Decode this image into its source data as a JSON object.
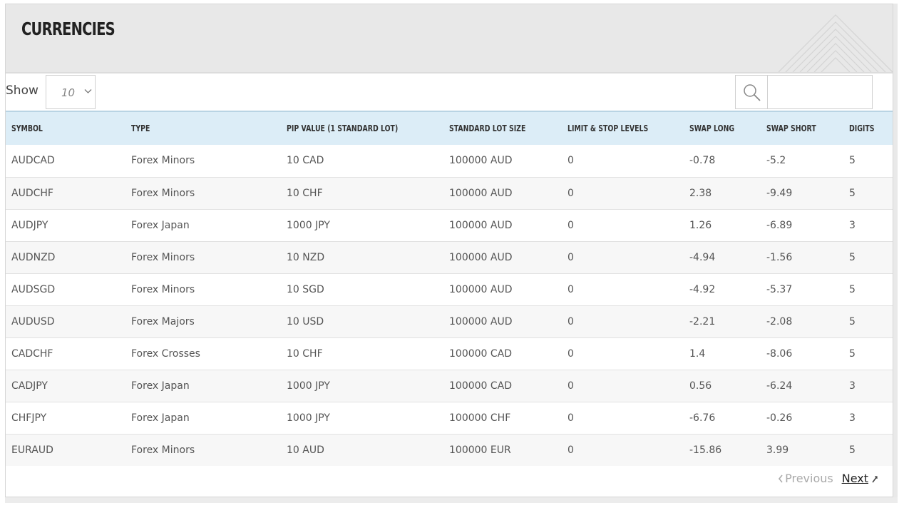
{
  "header": {
    "title": "Currencies"
  },
  "controls": {
    "show_label": "Show",
    "page_size": "10",
    "search_value": ""
  },
  "table": {
    "columns": [
      "Symbol",
      "Type",
      "Pip value (1 standard lot)",
      "Standard lot size",
      "Limit & Stop levels",
      "Swap long",
      "Swap short",
      "Digits"
    ],
    "rows": [
      [
        "AUDCAD",
        "Forex Minors",
        "10 CAD",
        "100000 AUD",
        "0",
        "-0.78",
        "-5.2",
        "5"
      ],
      [
        "AUDCHF",
        "Forex Minors",
        "10 CHF",
        "100000 AUD",
        "0",
        "2.38",
        "-9.49",
        "5"
      ],
      [
        "AUDJPY",
        "Forex Japan",
        "1000 JPY",
        "100000 AUD",
        "0",
        "1.26",
        "-6.89",
        "3"
      ],
      [
        "AUDNZD",
        "Forex Minors",
        "10 NZD",
        "100000 AUD",
        "0",
        "-4.94",
        "-1.56",
        "5"
      ],
      [
        "AUDSGD",
        "Forex Minors",
        "10 SGD",
        "100000 AUD",
        "0",
        "-4.92",
        "-5.37",
        "5"
      ],
      [
        "AUDUSD",
        "Forex Majors",
        "10 USD",
        "100000 AUD",
        "0",
        "-2.21",
        "-2.08",
        "5"
      ],
      [
        "CADCHF",
        "Forex Crosses",
        "10 CHF",
        "100000 CAD",
        "0",
        "1.4",
        "-8.06",
        "5"
      ],
      [
        "CADJPY",
        "Forex Japan",
        "1000 JPY",
        "100000 CAD",
        "0",
        "0.56",
        "-6.24",
        "3"
      ],
      [
        "CHFJPY",
        "Forex Japan",
        "1000 JPY",
        "100000 CHF",
        "0",
        "-6.76",
        "-0.26",
        "3"
      ],
      [
        "EURAUD",
        "Forex Minors",
        "10 AUD",
        "100000 EUR",
        "0",
        "-15.86",
        "3.99",
        "5"
      ]
    ]
  },
  "pagination": {
    "previous_label": "Previous",
    "next_label": "Next"
  },
  "icons": {
    "search": "search-icon",
    "chevron": "chevron-down-icon",
    "previous": "chevron-left-icon",
    "next": "chevron-right-icon"
  },
  "colors": {
    "header_bg": "#e8e8e8",
    "table_header_bg": "#dcedf7",
    "row_alt_bg": "#f7f7f7"
  }
}
